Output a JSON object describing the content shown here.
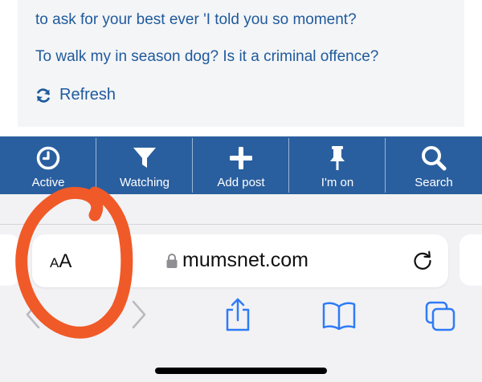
{
  "threads": [
    {
      "text": "to ask for your best ever 'I told you so moment?"
    },
    {
      "text": "To walk my in season dog? Is it a criminal offence?"
    }
  ],
  "refresh_label": "Refresh",
  "nav": [
    {
      "label": "Active",
      "icon": "clock-icon"
    },
    {
      "label": "Watching",
      "icon": "funnel-icon"
    },
    {
      "label": "Add post",
      "icon": "plus-icon"
    },
    {
      "label": "I'm on",
      "icon": "pin-icon"
    },
    {
      "label": "Search",
      "icon": "search-icon"
    }
  ],
  "browser": {
    "aa_small": "A",
    "aa_big": "A",
    "url": "mumsnet.com"
  },
  "colors": {
    "nav_bg": "#2a5f9f",
    "link": "#1f5a9c",
    "ios_blue": "#2f7bf6",
    "annotation": "#f05a28"
  }
}
